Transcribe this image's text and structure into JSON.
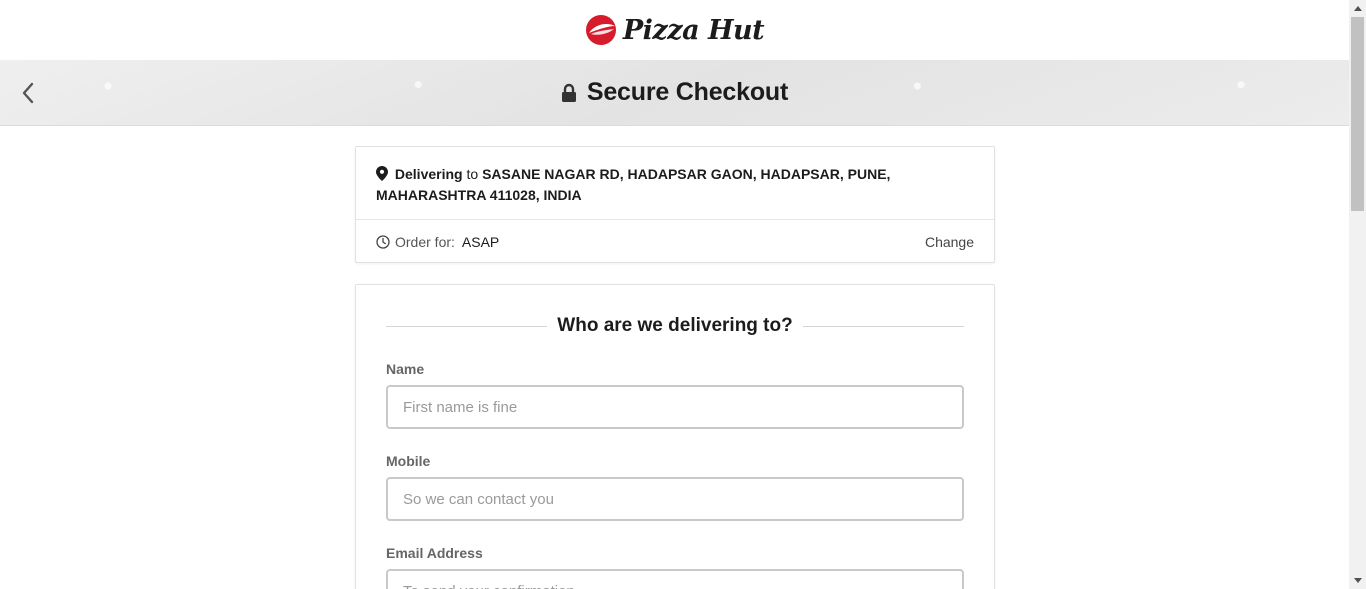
{
  "brand": {
    "name": "Pizza Hut",
    "accent": "#d61c2c"
  },
  "banner": {
    "back_icon": "chevron-left-icon",
    "lock_icon": "lock-icon",
    "title": "Secure Checkout"
  },
  "delivery": {
    "pin_icon": "map-pin-icon",
    "mode_label": "Delivering",
    "connector": "to",
    "address": "SASANE NAGAR RD, HADAPSAR GAON, HADAPSAR, PUNE, MAHARASHTRA 411028, INDIA",
    "clock_icon": "clock-icon",
    "order_for_label": "Order for:",
    "order_for_value": "ASAP",
    "change_label": "Change"
  },
  "form": {
    "heading": "Who are we delivering to?",
    "fields": [
      {
        "label": "Name",
        "placeholder": "First name is fine",
        "value": ""
      },
      {
        "label": "Mobile",
        "placeholder": "So we can contact you",
        "value": ""
      },
      {
        "label": "Email Address",
        "placeholder": "To send your confirmation",
        "value": ""
      }
    ]
  }
}
